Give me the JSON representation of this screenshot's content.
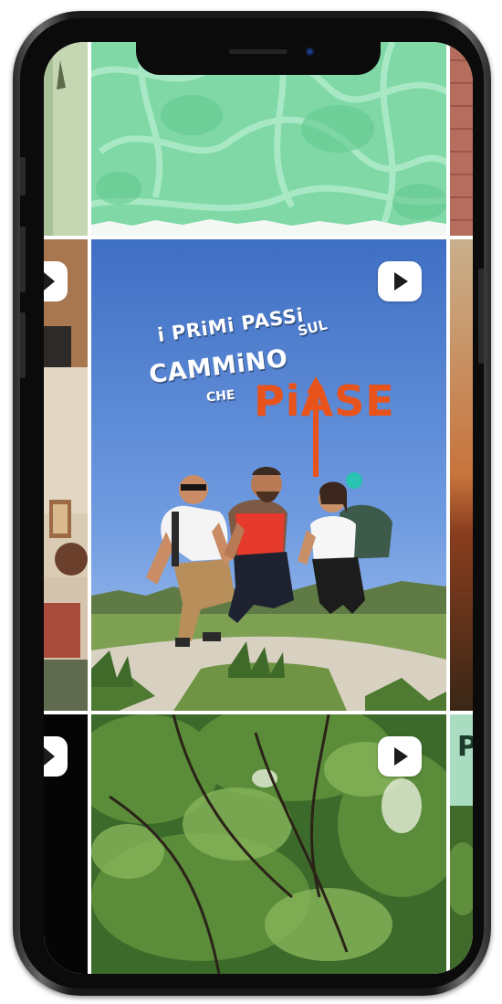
{
  "post": {
    "title_line1": "i PRiMi PASSi",
    "title_line2": "CAMMiNO",
    "title_sul": "SUL",
    "title_che": "CHE",
    "title_piase": "PiASE",
    "accent_color": "#e8531b"
  },
  "grid": {
    "side_letter": "P",
    "video_indicator": "play-icon"
  }
}
